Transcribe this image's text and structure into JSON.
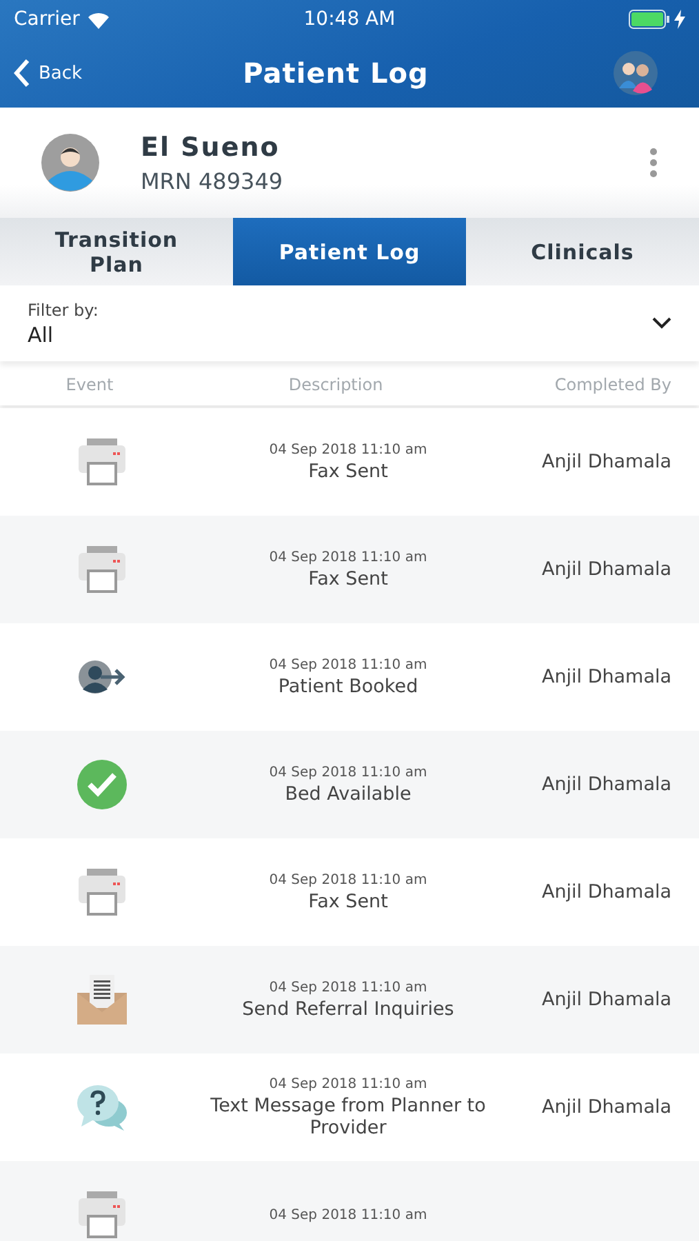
{
  "status_bar": {
    "carrier": "Carrier",
    "time": "10:48 AM"
  },
  "nav": {
    "back": "Back",
    "title": "Patient Log"
  },
  "patient": {
    "name": "El Sueno",
    "mrn": "MRN 489349"
  },
  "tabs": [
    {
      "label": "Transition Plan",
      "selected": false
    },
    {
      "label": "Patient Log",
      "selected": true
    },
    {
      "label": "Clinicals",
      "selected": false
    }
  ],
  "filter": {
    "label": "Filter by:",
    "value": "All"
  },
  "table": {
    "columns": [
      "Event",
      "Description",
      "Completed By"
    ],
    "rows": [
      {
        "kind": "fax",
        "date": "04 Sep 2018 11:10 am",
        "description": "Fax Sent",
        "completed_by": "Anjil Dhamala"
      },
      {
        "kind": "fax",
        "date": "04 Sep 2018 11:10 am",
        "description": "Fax Sent",
        "completed_by": "Anjil Dhamala"
      },
      {
        "kind": "booked",
        "date": "04 Sep 2018 11:10 am",
        "description": "Patient Booked",
        "completed_by": "Anjil Dhamala"
      },
      {
        "kind": "check",
        "date": "04 Sep 2018 11:10 am",
        "description": "Bed Available",
        "completed_by": "Anjil Dhamala"
      },
      {
        "kind": "fax",
        "date": "04 Sep 2018 11:10 am",
        "description": "Fax Sent",
        "completed_by": "Anjil Dhamala"
      },
      {
        "kind": "envelope",
        "date": "04 Sep 2018 11:10 am",
        "description": "Send Referral Inquiries",
        "completed_by": "Anjil Dhamala"
      },
      {
        "kind": "question",
        "date": "04 Sep 2018 11:10 am",
        "description": "Text Message from Planner to Provider",
        "completed_by": "Anjil Dhamala"
      },
      {
        "kind": "fax",
        "date": "04 Sep 2018 11:10 am"
      }
    ]
  }
}
